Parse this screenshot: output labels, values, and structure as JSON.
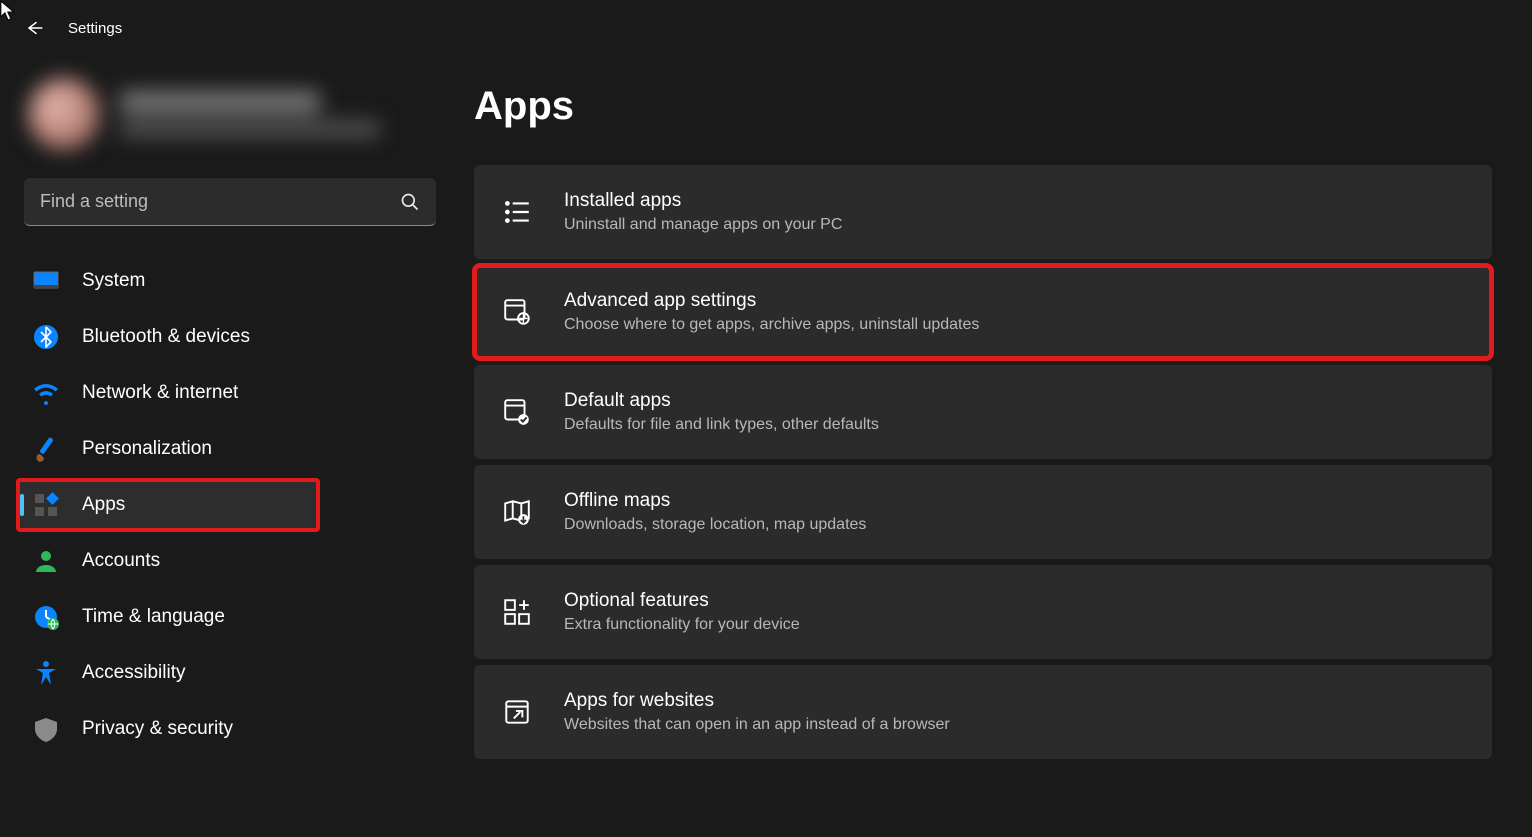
{
  "app": {
    "title": "Settings"
  },
  "search": {
    "placeholder": "Find a setting"
  },
  "page": {
    "title": "Apps"
  },
  "sidebar": {
    "items": [
      {
        "id": "system",
        "label": "System"
      },
      {
        "id": "bluetooth",
        "label": "Bluetooth & devices"
      },
      {
        "id": "network",
        "label": "Network & internet"
      },
      {
        "id": "personalization",
        "label": "Personalization"
      },
      {
        "id": "apps",
        "label": "Apps"
      },
      {
        "id": "accounts",
        "label": "Accounts"
      },
      {
        "id": "time",
        "label": "Time & language"
      },
      {
        "id": "accessibility",
        "label": "Accessibility"
      },
      {
        "id": "privacy",
        "label": "Privacy & security"
      }
    ],
    "active_id": "apps",
    "highlighted_id": "apps"
  },
  "cards": [
    {
      "id": "installed",
      "title": "Installed apps",
      "desc": "Uninstall and manage apps on your PC"
    },
    {
      "id": "advanced",
      "title": "Advanced app settings",
      "desc": "Choose where to get apps, archive apps, uninstall updates"
    },
    {
      "id": "default",
      "title": "Default apps",
      "desc": "Defaults for file and link types, other defaults"
    },
    {
      "id": "offline-maps",
      "title": "Offline maps",
      "desc": "Downloads, storage location, map updates"
    },
    {
      "id": "optional",
      "title": "Optional features",
      "desc": "Extra functionality for your device"
    },
    {
      "id": "apps-websites",
      "title": "Apps for websites",
      "desc": "Websites that can open in an app instead of a browser"
    }
  ],
  "highlighted_card_id": "advanced"
}
